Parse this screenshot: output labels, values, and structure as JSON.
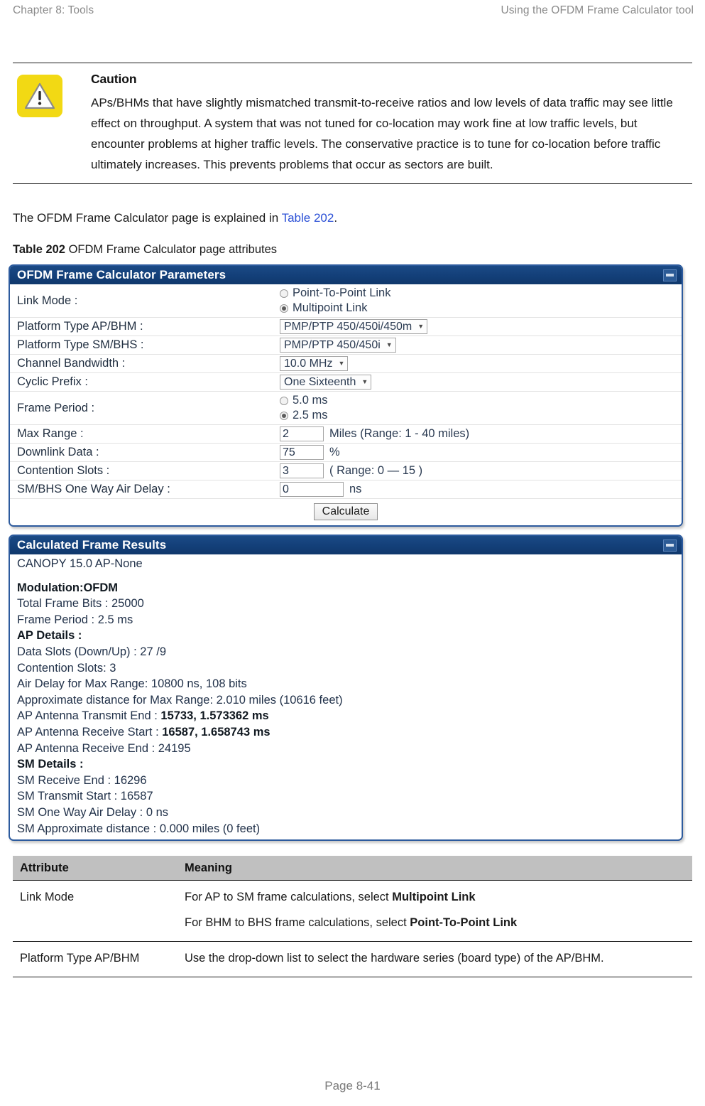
{
  "header": {
    "left": "Chapter 8:  Tools",
    "right": "Using the OFDM Frame Calculator tool"
  },
  "caution": {
    "icon": "warning-triangle-icon",
    "title": "Caution",
    "text": "APs/BHMs that have slightly mismatched transmit-to-receive ratios and low levels of data traffic may see little effect on throughput. A system that was not tuned for co-location may work fine at low traffic levels, but encounter problems at higher traffic levels. The conservative practice is to tune for co-location before traffic ultimately increases. This prevents problems that occur as sectors are built.",
    "icon_color": "#f2d914"
  },
  "intro": {
    "before_link": "The OFDM Frame Calculator page is explained in ",
    "link": "Table 202",
    "after_link": ".",
    "link_color": "#2a4fd6"
  },
  "table_caption": {
    "label": "Table 202",
    "text": " OFDM Frame Calculator page attributes"
  },
  "params_panel": {
    "title": "OFDM Frame Calculator Parameters",
    "minimize_icon": "minimize-icon",
    "header_color": "#133f78",
    "border_color": "#2d5b9e",
    "rows": {
      "link_mode": {
        "label": "Link Mode :",
        "options": [
          {
            "label": "Point-To-Point Link",
            "selected": false
          },
          {
            "label": "Multipoint Link",
            "selected": true
          }
        ]
      },
      "platform_ap": {
        "label": "Platform Type AP/BHM :",
        "value": "PMP/PTP 450/450i/450m"
      },
      "platform_sm": {
        "label": "Platform Type SM/BHS :",
        "value": "PMP/PTP 450/450i"
      },
      "channel_bandwidth": {
        "label": "Channel Bandwidth :",
        "value": "10.0 MHz"
      },
      "cyclic_prefix": {
        "label": "Cyclic Prefix :",
        "value": "One Sixteenth"
      },
      "frame_period": {
        "label": "Frame Period :",
        "options": [
          {
            "label": "5.0 ms",
            "selected": false
          },
          {
            "label": "2.5 ms",
            "selected": true
          }
        ]
      },
      "max_range": {
        "label": "Max Range :",
        "value": "2",
        "unit": "Miles (Range: 1 - 40 miles)"
      },
      "downlink_data": {
        "label": "Downlink Data :",
        "value": "75",
        "unit": "%"
      },
      "contention_slots": {
        "label": "Contention Slots :",
        "value": "3",
        "unit": "( Range: 0 — 15 )"
      },
      "air_delay": {
        "label": "SM/BHS One Way Air Delay :",
        "value": "0",
        "unit": "ns"
      }
    },
    "calculate_button": "Calculate"
  },
  "results_panel": {
    "title": "Calculated Frame Results",
    "minimize_icon": "minimize-icon",
    "lines": [
      {
        "text": "CANOPY 15.0  AP-None",
        "bold": false
      },
      {
        "text": "",
        "bold": false,
        "spacer": true
      },
      {
        "text": "Modulation:OFDM",
        "bold": true
      },
      {
        "text": "Total Frame Bits : 25000",
        "bold": false
      },
      {
        "text": "Frame Period : 2.5 ms",
        "bold": false
      },
      {
        "text": "AP Details :",
        "bold": true
      },
      {
        "text": "Data Slots (Down/Up) : 27 /9",
        "bold": false
      },
      {
        "text": "Contention Slots: 3",
        "bold": false
      },
      {
        "text": "Air Delay for Max Range: 10800 ns, 108 bits",
        "bold": false
      },
      {
        "text": "Approximate distance for Max Range: 2.010 miles (10616 feet)",
        "bold": false
      },
      {
        "text": "AP Antenna Transmit End : ",
        "bold": false,
        "bold_tail": "15733, 1.573362 ms"
      },
      {
        "text": "AP Antenna Receive Start : ",
        "bold": false,
        "bold_tail": "16587, 1.658743 ms"
      },
      {
        "text": "AP Antenna Receive End : 24195",
        "bold": false
      },
      {
        "text": "SM Details :",
        "bold": true
      },
      {
        "text": "SM Receive End : 16296",
        "bold": false
      },
      {
        "text": "SM Transmit Start : 16587",
        "bold": false
      },
      {
        "text": "SM One Way Air Delay : 0 ns",
        "bold": false
      },
      {
        "text": "SM Approximate distance : 0.000 miles (0 feet)",
        "bold": false
      }
    ]
  },
  "attr_table": {
    "headers": {
      "attribute": "Attribute",
      "meaning": "Meaning"
    },
    "header_bg": "#c0c0c0",
    "rows": [
      {
        "attribute": "Link Mode",
        "meaning_lines": [
          {
            "prefix": "For AP to SM frame calculations, select ",
            "bold": "Multipoint Link"
          },
          {
            "prefix": "For BHM to BHS frame calculations, select ",
            "bold": "Point-To-Point Link"
          }
        ]
      },
      {
        "attribute": "Platform Type AP/BHM",
        "meaning_lines": [
          {
            "prefix": "Use the drop-down list to select the hardware series (board type) of the AP/BHM.",
            "bold": ""
          }
        ]
      }
    ]
  },
  "footer": {
    "page": "Page 8-41"
  }
}
